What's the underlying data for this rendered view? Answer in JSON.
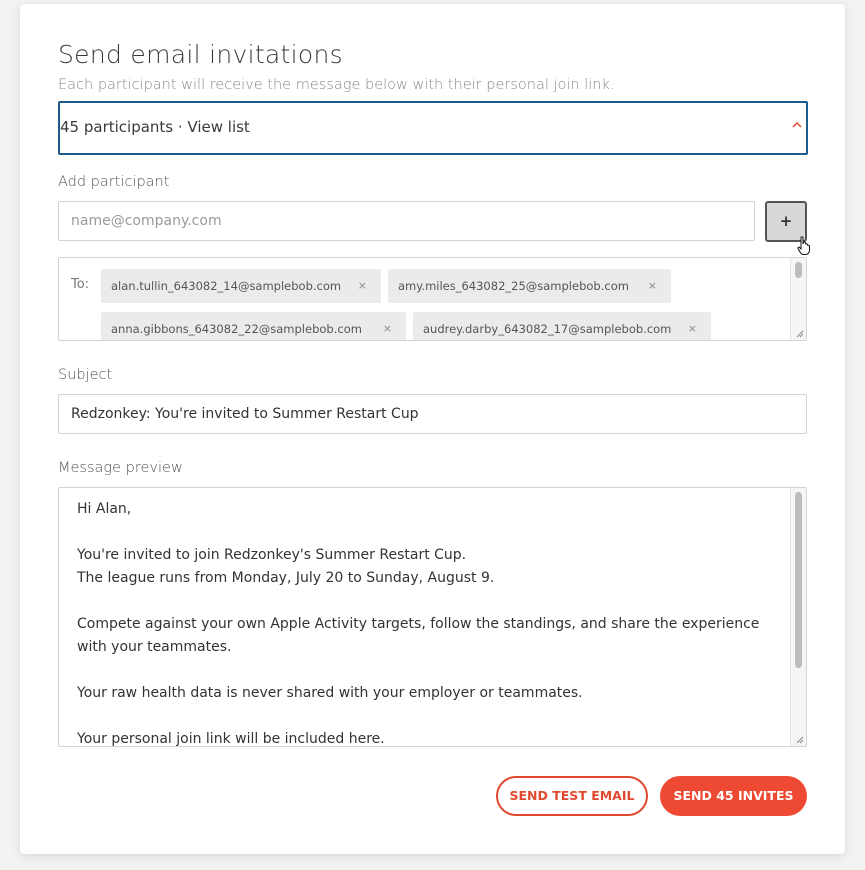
{
  "dialog": {
    "title": "Send email invitations",
    "subtitle": "Each participant will receive the message below with their personal join link."
  },
  "participants_select": {
    "value": "45 participants · View list",
    "chevron_icon": "chevron-up-icon"
  },
  "add_participant": {
    "label": "Add participant",
    "placeholder": "name@company.com",
    "value": "",
    "button_symbol": "+",
    "button_icon": "plus-icon"
  },
  "recipients": {
    "to_label": "To:",
    "remove_symbol": "×",
    "chips": [
      "alan.tullin_643082_14@samplebob.com",
      "amy.miles_643082_25@samplebob.com",
      "anna.gibbons_643082_22@samplebob.com",
      "audrey.darby_643082_17@samplebob.com"
    ]
  },
  "subject": {
    "label": "Subject",
    "value": "Redzonkey: You're invited to Summer Restart Cup"
  },
  "message": {
    "label": "Message preview",
    "lines": [
      "Hi Alan,",
      "You're invited to join Redzonkey's Summer Restart Cup.",
      "The league runs from Monday, July 20 to Sunday, August 9.",
      "Compete against your own Apple Activity targets, follow the standings, and share the experience with your teammates.",
      "Your raw health data is never shared with your employer or teammates.",
      "Your personal join link will be included here."
    ]
  },
  "actions": {
    "send_test_label": "SEND TEST EMAIL",
    "send_invites_label": "SEND 45 INVITES"
  },
  "colors": {
    "accent": "#ee4a33",
    "focus_border": "#1f5b8c"
  }
}
